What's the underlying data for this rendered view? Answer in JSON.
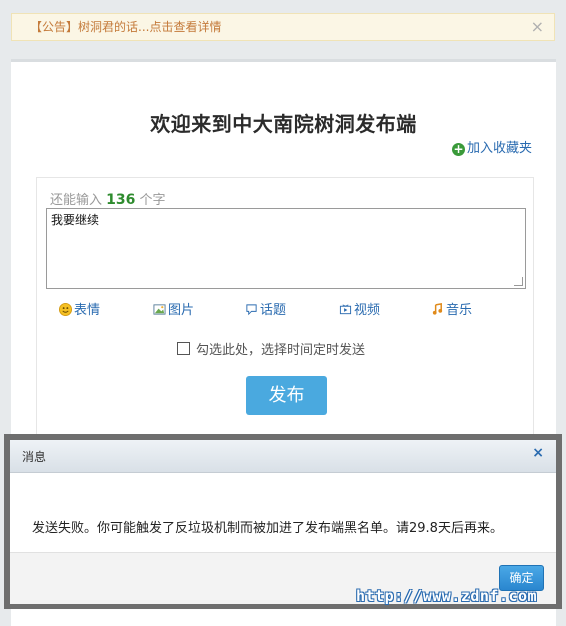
{
  "notice": {
    "tag": "【公告】",
    "text": "树洞君的话...点击查看详情",
    "close_glyph": "×"
  },
  "header": {
    "title": "欢迎来到中大南院树洞发布端",
    "favorite_label": "加入收藏夹"
  },
  "composer": {
    "count_prefix": "还能输入",
    "count_value": "136",
    "count_suffix": "个字",
    "textarea_value": "我要继续"
  },
  "tools": [
    {
      "label": "表情",
      "icon": "smiley-icon"
    },
    {
      "label": "图片",
      "icon": "image-icon"
    },
    {
      "label": "话题",
      "icon": "topic-icon"
    },
    {
      "label": "视频",
      "icon": "video-icon"
    },
    {
      "label": "音乐",
      "icon": "music-icon"
    }
  ],
  "schedule": {
    "label": "勾选此处，选择时间定时发送",
    "checked": false
  },
  "publish_label": "发布",
  "dialog": {
    "title": "消息",
    "close_glyph": "×",
    "message": "发送失败。你可能触发了反垃圾机制而被加进了发布端黑名单。请29.8天后再来。",
    "ok_label": "确定"
  },
  "watermark": "http://www.zdnf.com",
  "colors": {
    "accent_blue": "#4aa9df",
    "link_blue": "#2a6bb0",
    "count_green": "#2e8b2e",
    "notice_text": "#c47a3a"
  }
}
